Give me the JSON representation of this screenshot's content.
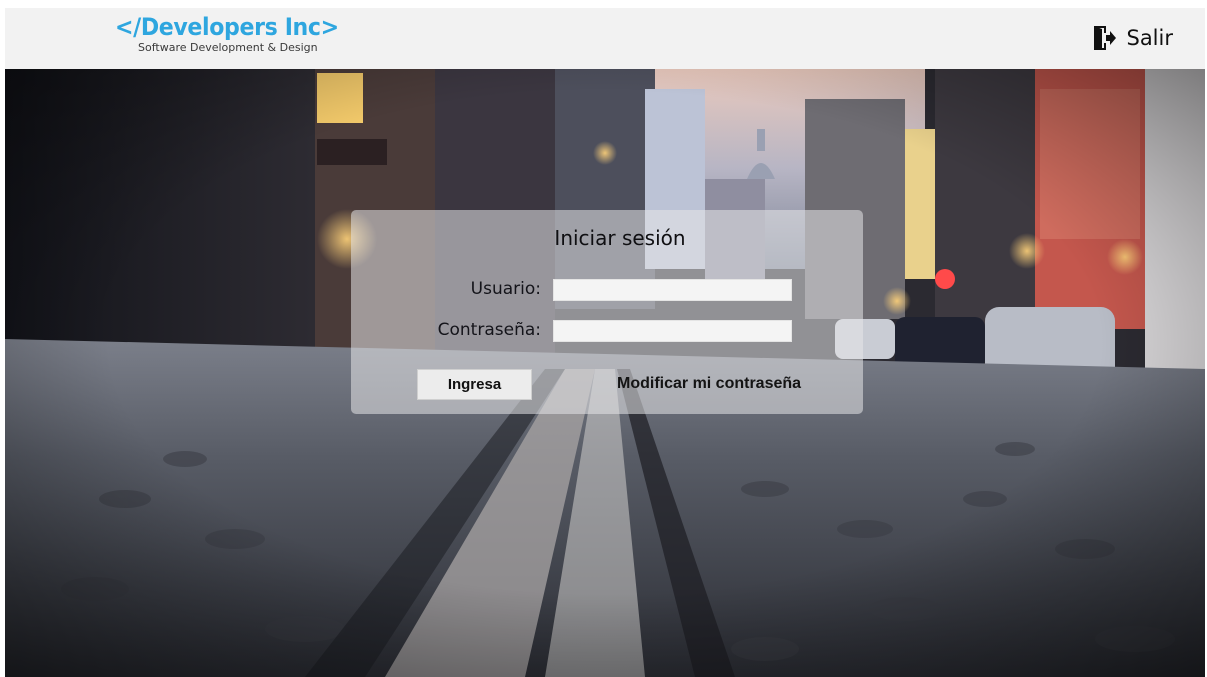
{
  "header": {
    "logo_title": "</Developers Inc>",
    "logo_subtitle": "Software Development & Design",
    "logout_label": "Salir"
  },
  "login": {
    "title": "Iniciar sesión",
    "username_label": "Usuario:",
    "username_value": "",
    "password_label": "Contraseña:",
    "password_value": "",
    "submit_label": "Ingresa",
    "change_password_label": "Modificar mi contraseña"
  },
  "colors": {
    "logo_accent": "#2ea6df",
    "header_background": "#f2f2f2"
  },
  "icons": {
    "logout": "door-exit-icon"
  }
}
